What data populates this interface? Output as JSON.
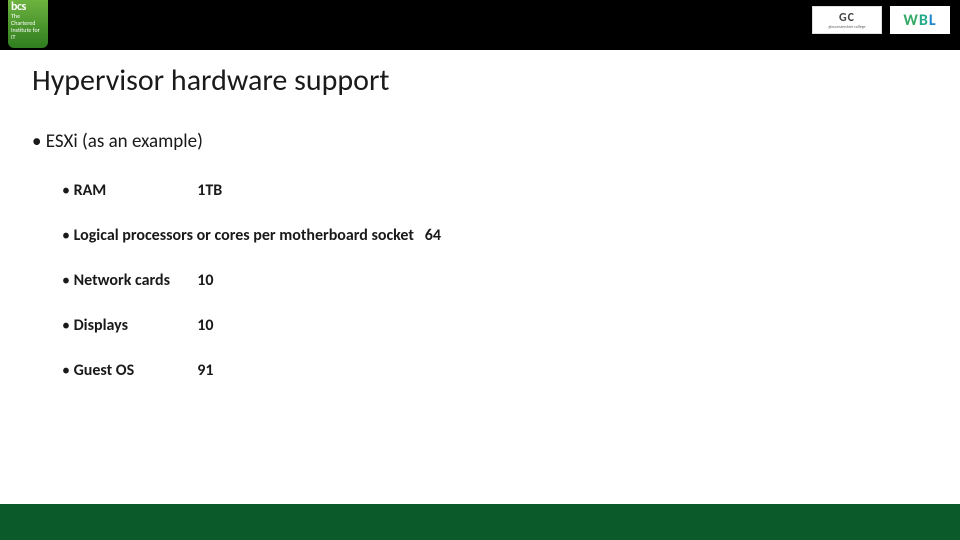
{
  "logos": {
    "bcs_big": "bcs",
    "bcs_small": "The Chartered Institute for IT",
    "gc_big": "GC",
    "gc_small": "gloucestershire college",
    "wbl_w": "W",
    "wbl_b": "B",
    "wbl_l": "L"
  },
  "title": "Hypervisor hardware support",
  "intro": "ESXi (as an example)",
  "specs": {
    "ram": {
      "label": "RAM",
      "value": "1TB"
    },
    "cores": {
      "label": "Logical processors or cores per motherboard socket",
      "value": "64"
    },
    "network": {
      "label": "Network cards",
      "value": "10"
    },
    "displays": {
      "label": "Displays",
      "value": "10"
    },
    "guest_os": {
      "label": "Guest OS",
      "value": "91"
    }
  }
}
